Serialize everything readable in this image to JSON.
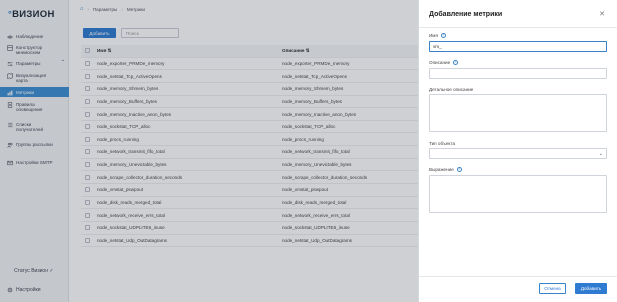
{
  "app": {
    "logo": "ВИЗИОН"
  },
  "sidebar": {
    "items": [
      {
        "label": "Наблюдение",
        "icon": "eye-icon"
      },
      {
        "label": "Конструктор мнемосхем",
        "icon": "layout-icon"
      },
      {
        "label": "Параметры",
        "icon": "sliders-icon"
      },
      {
        "label": "Визуализация карта",
        "icon": "map-icon"
      },
      {
        "label": "Метрики",
        "icon": "chart-icon"
      },
      {
        "label": "Правила оповещения",
        "icon": "rules-icon"
      },
      {
        "label": "Списки получателей",
        "icon": "list-icon"
      },
      {
        "label": "Группы рассылки",
        "icon": "group-icon"
      },
      {
        "label": "Настройки SMTP",
        "icon": "mail-icon"
      }
    ],
    "status": "Статус Визион",
    "settings": "Настройки"
  },
  "breadcrumb": {
    "items": [
      "Параметры",
      "Метрики"
    ]
  },
  "toolbar": {
    "add_label": "Добавить",
    "search_placeholder": "Поиск"
  },
  "table": {
    "headers": {
      "name": "Имя",
      "description": "Описание"
    },
    "rows": [
      {
        "name": "node_exporter_PRMDe_memory",
        "description": "node_exporter_PRMDe_memory"
      },
      {
        "name": "node_netstat_Tcp_ActiveOpens",
        "description": "node_netstat_Tcp_ActiveOpens"
      },
      {
        "name": "node_memory_Shmem_bytes",
        "description": "node_memory_Shmem_bytes"
      },
      {
        "name": "node_memory_Buffers_bytes",
        "description": "node_memory_Buffers_bytes"
      },
      {
        "name": "node_memory_Inactive_anon_bytes",
        "description": "node_memory_Inactive_anon_bytes"
      },
      {
        "name": "node_sockstat_TCP_alloc",
        "description": "node_sockstat_TCP_alloc"
      },
      {
        "name": "node_procs_running",
        "description": "node_procs_running"
      },
      {
        "name": "node_network_transmit_fifo_total",
        "description": "node_network_transmit_fifo_total"
      },
      {
        "name": "node_memory_Unevictable_bytes",
        "description": "node_memory_Unevictable_bytes"
      },
      {
        "name": "node_scrape_collector_duration_seconds",
        "description": "node_scrape_collector_duration_seconds"
      },
      {
        "name": "node_vmstat_pswpout",
        "description": "node_vmstat_pswpout"
      },
      {
        "name": "node_disk_reads_merged_total",
        "description": "node_disk_reads_merged_total"
      },
      {
        "name": "node_network_receive_errs_total",
        "description": "node_network_receive_errs_total"
      },
      {
        "name": "node_sockstat_UDPLITE6_inuse",
        "description": "node_sockstat_UDPLITE6_inuse"
      },
      {
        "name": "node_netstat_Udp_OutDatagrams",
        "description": "node_netstat_Udp_OutDatagrams"
      }
    ]
  },
  "drawer": {
    "title": "Добавление метрики",
    "name_label": "Имя",
    "name_value": "vm_",
    "description_label": "Описание",
    "description_value": "",
    "detailed_label": "Детальное описание",
    "detailed_value": "",
    "object_type_label": "Тип объекта",
    "object_type_value": "",
    "expression_label": "Выражение",
    "expression_value": "",
    "cancel_label": "Отмена",
    "submit_label": "Добавить"
  },
  "colors": {
    "accent": "#2e7bd1",
    "active_nav": "#3b8ed4"
  }
}
